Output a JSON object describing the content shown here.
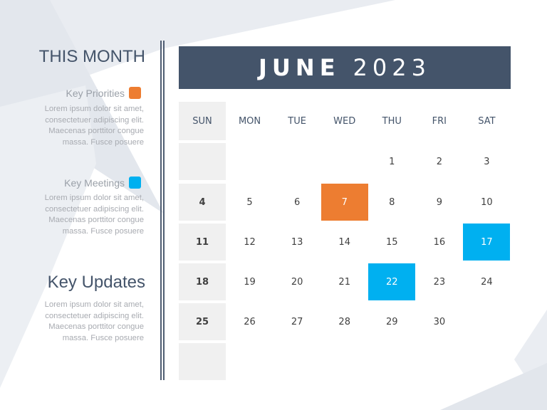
{
  "sidebar": {
    "title": "THIS MONTH",
    "legend": [
      {
        "label": "Key Priorities",
        "color": "#ed7d31",
        "text": [
          "Lorem ipsum dolor sit amet,",
          "consectetuer adipiscing elit.",
          "Maecenas porttitor congue",
          "massa. Fusce posuere"
        ]
      },
      {
        "label": "Key Meetings",
        "color": "#00b0f0",
        "text": [
          "Lorem ipsum dolor sit amet,",
          "consectetuer adipiscing elit.",
          "Maecenas porttitor congue",
          "massa. Fusce posuere"
        ]
      }
    ],
    "updates": {
      "title": "Key Updates",
      "text": [
        "Lorem ipsum dolor sit amet,",
        "consectetuer adipiscing elit.",
        "Maecenas porttitor congue",
        "massa. Fusce posuere"
      ]
    }
  },
  "calendar": {
    "month": "JUNE",
    "year": "2023",
    "weekdays": [
      "SUN",
      "MON",
      "TUE",
      "WED",
      "THU",
      "FRI",
      "SAT"
    ],
    "weeks": [
      [
        "",
        "",
        "",
        "",
        "1",
        "2",
        "3"
      ],
      [
        "4",
        "5",
        "6",
        "7",
        "8",
        "9",
        "10"
      ],
      [
        "11",
        "12",
        "13",
        "14",
        "15",
        "16",
        "17"
      ],
      [
        "18",
        "19",
        "20",
        "21",
        "22",
        "23",
        "24"
      ],
      [
        "25",
        "26",
        "27",
        "28",
        "29",
        "30",
        ""
      ],
      [
        "",
        "",
        "",
        "",
        "",
        "",
        ""
      ]
    ],
    "highlights": [
      {
        "day": "7",
        "type": "key-priority",
        "color": "#ed7d31"
      },
      {
        "day": "17",
        "type": "key-meeting",
        "color": "#00b0f0"
      },
      {
        "day": "22",
        "type": "key-meeting",
        "color": "#00b0f0"
      }
    ],
    "colors": {
      "header": "#44546a",
      "sunday_bg": "#f0f0f0"
    }
  }
}
